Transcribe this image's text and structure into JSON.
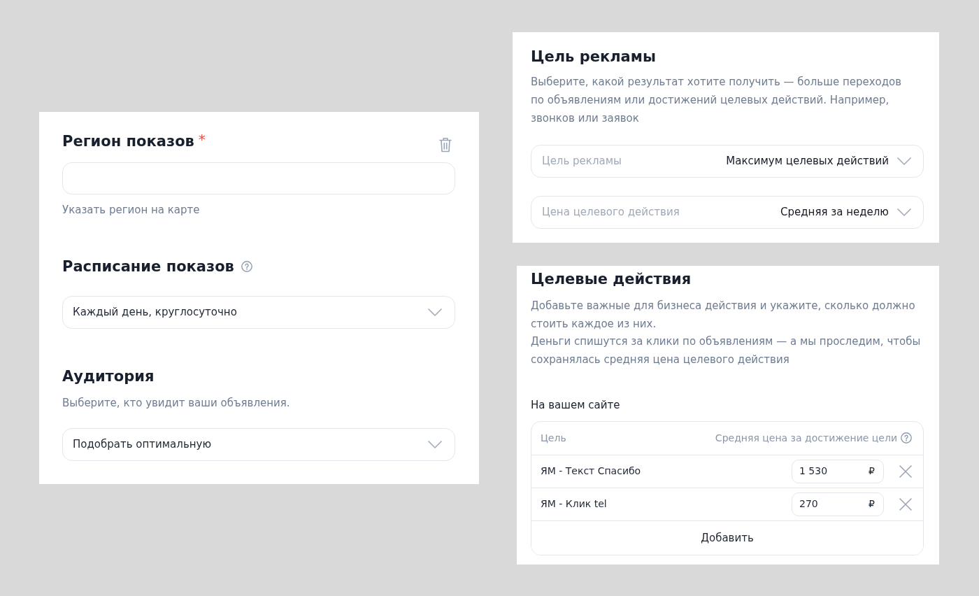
{
  "targeting_card": {
    "region": {
      "title": "Регион показов",
      "required_mark": "*",
      "map_link": "Указать регион на карте"
    },
    "schedule": {
      "title": "Расписание показов",
      "value": "Каждый день, круглосуточно"
    },
    "audience": {
      "title": "Аудитория",
      "description": "Выберите, кто увидит ваши объявления.",
      "value": "Подобрать оптимальную"
    }
  },
  "ad_goal_card": {
    "title": "Цель рекламы",
    "description": "Выберите, какой результат хотите получить — больше переходов по объявлениям или достижений целевых действий. Например, звонков или заявок",
    "fields": [
      {
        "label": "Цель рекламы",
        "value": "Максимум целевых действий"
      },
      {
        "label": "Цена целевого действия",
        "value": "Средняя за неделю"
      }
    ]
  },
  "target_actions_card": {
    "title": "Целевые действия",
    "paragraphs": [
      "Добавьте важные для бизнеса действия и укажите, сколько должно стоить каждое из них.",
      "Деньги спишутся за клики по объявлениям — а мы проследим, чтобы сохранялась средняя цена целевого действия"
    ],
    "section_title": "На вашем сайте",
    "table": {
      "columns": [
        "Цель",
        "Средняя цена за достижение цели"
      ],
      "rows": [
        {
          "goal": "ЯМ - Текст Спасибо",
          "price": "1 530",
          "currency": "₽"
        },
        {
          "goal": "ЯМ - Клик tel",
          "price": "270",
          "currency": "₽"
        }
      ],
      "add_button": "Добавить"
    }
  }
}
